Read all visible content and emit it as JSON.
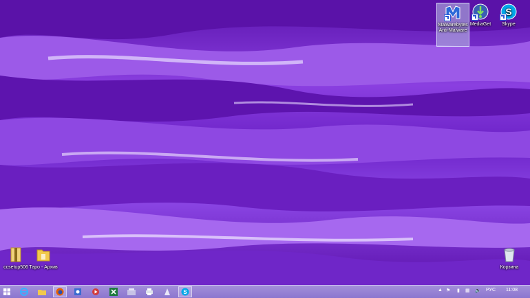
{
  "desktop": {
    "top_icons": [
      {
        "label": "Malwarebytes Anti-Malware",
        "icon": "malwarebytes-icon"
      },
      {
        "label": "MediaGet",
        "icon": "mediaget-icon"
      },
      {
        "label": "Skype",
        "icon": "skype-icon"
      }
    ],
    "bottom_icons": [
      {
        "label": "ccsetup506",
        "icon": "archive-folder-icon"
      },
      {
        "label": "Таро - Архив",
        "icon": "folder-icon"
      }
    ],
    "recycle_bin": {
      "label": "Корзина",
      "icon": "recycle-bin-icon"
    }
  },
  "taskbar": {
    "items": [
      "windows-start-icon",
      "internet-explorer-icon",
      "file-explorer-icon",
      "firefox-icon",
      "settings-app-icon",
      "media-app-icon",
      "excel-icon",
      "folder-app-icon",
      "print-app-icon",
      "notepad-app-icon",
      "skype-taskbar-icon"
    ],
    "language": "РУС",
    "time": "11:08"
  },
  "colors": {
    "accent": "#7a2fd6",
    "taskbar": "#9a86d6"
  }
}
